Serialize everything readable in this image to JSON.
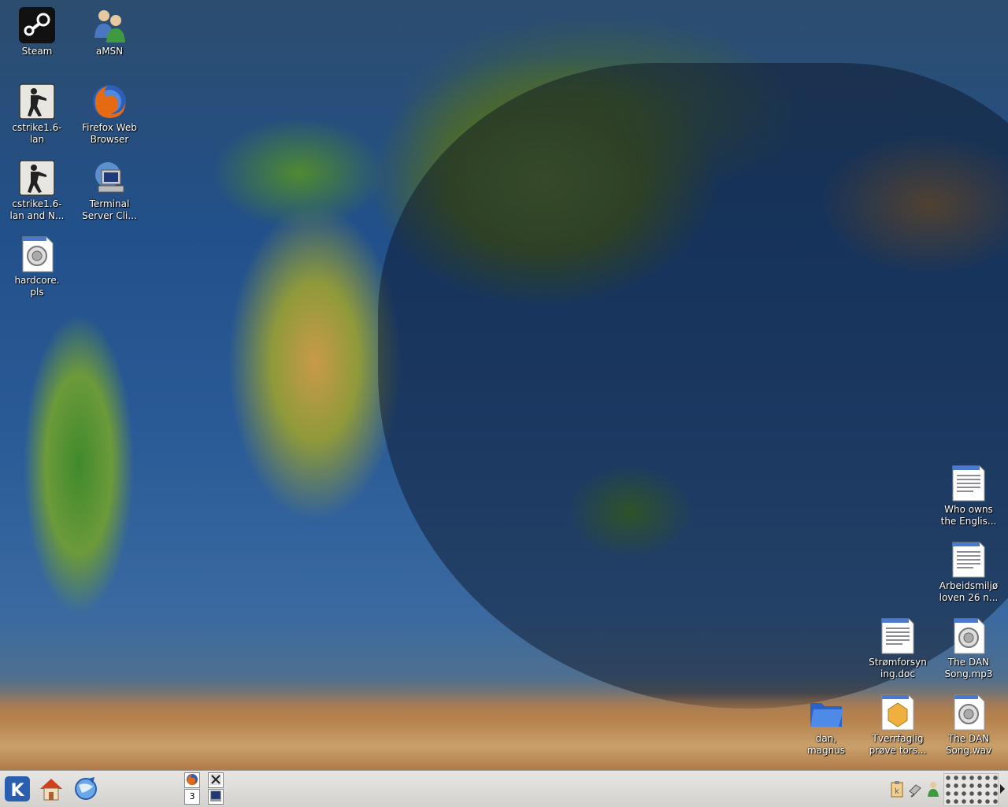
{
  "desktop_icons": {
    "steam": "Steam",
    "amsn": "aMSN",
    "cstrike_lan": "cstrike1.6-\nlan",
    "firefox": "Firefox Web\nBrowser",
    "cstrike_lan_and": "cstrike1.6-\nlan and N...",
    "terminal_server": "Terminal\nServer Cli...",
    "hardcore": "hardcore.\npls",
    "who_owns": "Who owns\nthe Englis...",
    "arbeidsmiljo": "Arbeidsmiljø\nloven 26 n...",
    "stromforsyning": "Strømforsyn\ning.doc",
    "dan_song_mp3": "The DAN\nSong.mp3",
    "dan_magnus": "dan,\nmagnus",
    "tverrfaglig": "Tverrfaglig\nprøve tors...",
    "dan_song_wav": "The DAN\nSong.wav"
  },
  "taskbar": {
    "pager_current": "3"
  },
  "icons": {
    "kmenu": "kde-menu-icon",
    "home": "home-folder-icon",
    "konqueror": "konqueror-browser-icon"
  }
}
